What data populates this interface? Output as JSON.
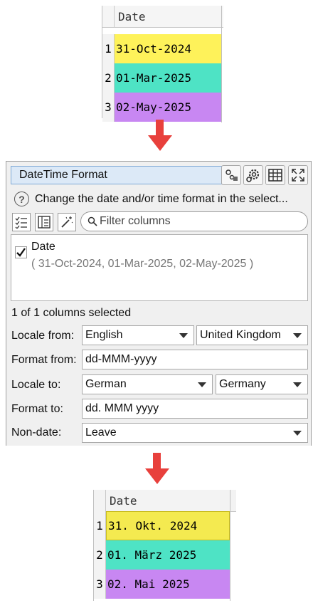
{
  "top_table": {
    "column_header": "Date",
    "rows": [
      {
        "num": "1",
        "value": "31-Oct-2024",
        "color": "#fef25a"
      },
      {
        "num": "2",
        "value": "01-Mar-2025",
        "color": "#4ee3c5"
      },
      {
        "num": "3",
        "value": "02-May-2025",
        "color": "#c887f2"
      }
    ]
  },
  "panel": {
    "title": "DateTime Format",
    "toolbar_icons": [
      "data-icon",
      "gear-icon",
      "table-icon",
      "maximize-icon"
    ],
    "description": "Change the date and/or time format in the select...",
    "search_placeholder": "Filter columns",
    "columns": [
      {
        "name": "Date",
        "sample": "( 31-Oct-2024, 01-Mar-2025, 02-May-2025 )",
        "checked": true
      }
    ],
    "selected_count": "1 of 1 columns selected",
    "fields": {
      "locale_from_label": "Locale from:",
      "locale_from_language": "English",
      "locale_from_country": "United Kingdom",
      "format_from_label": "Format from:",
      "format_from_value": "dd-MMM-yyyy",
      "locale_to_label": "Locale to:",
      "locale_to_language": "German",
      "locale_to_country": "Germany",
      "format_to_label": "Format to:",
      "format_to_value": "dd. MMM yyyy",
      "non_date_label": "Non-date:",
      "non_date_value": "Leave"
    }
  },
  "bottom_table": {
    "column_header": "Date",
    "rows": [
      {
        "num": "1",
        "value": "31. Okt. 2024",
        "color": "#f4ea50"
      },
      {
        "num": "2",
        "value": "01. März 2025",
        "color": "#4ee3c5"
      },
      {
        "num": "3",
        "value": "02. Mai 2025",
        "color": "#c887f2"
      }
    ]
  },
  "colors": {
    "arrow": "#e8403c",
    "title_bg": "#dce9f7"
  }
}
